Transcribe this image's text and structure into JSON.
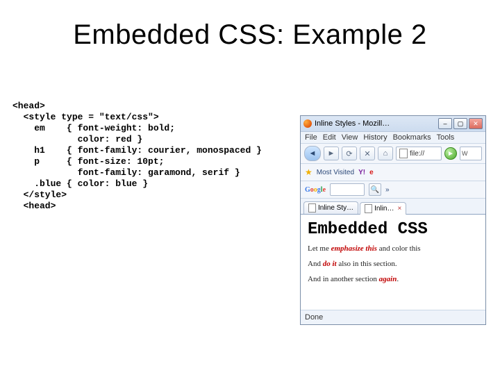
{
  "title": "Embedded CSS: Example 2",
  "code_lines": [
    "<head>",
    "  <style type = \"text/css\">",
    "    em    { font-weight: bold;",
    "            color: red }",
    "    h1    { font-family: courier, monospaced }",
    "    p     { font-size: 10pt;",
    "            font-family: garamond, serif }",
    "    .blue { color: blue }",
    "  </style>",
    "  <head>"
  ],
  "browser": {
    "window_title": "Inline Styles - Mozill…",
    "menu": {
      "file": "File",
      "edit": "Edit",
      "view": "View",
      "history": "History",
      "bookmarks": "Bookmarks",
      "tools": "Tools"
    },
    "toolbar": {
      "back": "◄",
      "forward": "►",
      "reload": "⟳",
      "stop": "✕",
      "home": "⌂",
      "url": "file://",
      "go": "►",
      "search_placeholder": "W"
    },
    "bookmarks_bar": {
      "most_visited": "Most Visited",
      "yahoo": "Y!",
      "ebay_icon": "e"
    },
    "google_bar": {
      "label": "Google",
      "search_btn": "🔍",
      "extra": "»"
    },
    "tabs": {
      "tab1": "Inline Sty…",
      "tab2": "Inlin…"
    },
    "page": {
      "heading": "Embedded CSS",
      "p1_pre": "Let me ",
      "p1_em": "emphasize this",
      "p1_post": " and color this ",
      "p2_pre": "And ",
      "p2_em": "do it",
      "p2_post": " also in this section.",
      "p3_pre": "And in another section ",
      "p3_em": "again",
      "p3_post": "."
    },
    "status": "Done"
  }
}
